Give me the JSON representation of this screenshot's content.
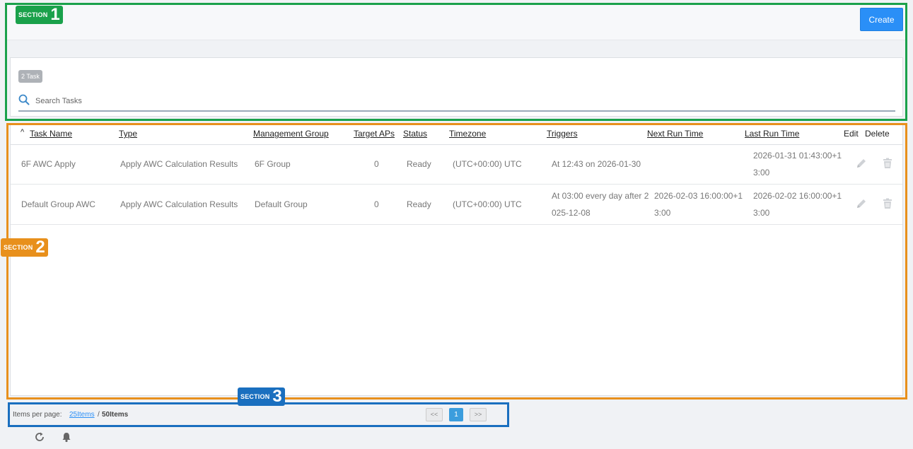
{
  "header": {
    "create_label": "Create"
  },
  "tasks": {
    "count_badge": "2 Task",
    "search_placeholder": "Search Tasks"
  },
  "table": {
    "sort_indicator": "^",
    "columns": {
      "task_name": "Task Name",
      "type": "Type",
      "management_group": "Management Group",
      "target_aps": "Target APs",
      "status": "Status",
      "timezone": "Timezone",
      "triggers": "Triggers",
      "next_run_time": "Next Run Time",
      "last_run_time": "Last Run Time",
      "edit": "Edit",
      "delete": "Delete"
    },
    "rows": [
      {
        "task_name": "6F AWC Apply",
        "type": "Apply AWC Calculation Results",
        "management_group": "6F Group",
        "target_aps": "0",
        "status": "Ready",
        "timezone": "(UTC+00:00) UTC",
        "triggers": "At 12:43 on 2026-01-30",
        "next_run_time": "",
        "last_run_time": "2026-01-31 01:43:00+13:00"
      },
      {
        "task_name": "Default Group AWC",
        "type": "Apply AWC Calculation Results",
        "management_group": "Default Group",
        "target_aps": "0",
        "status": "Ready",
        "timezone": "(UTC+00:00) UTC",
        "triggers": "At 03:00 every day after 2025-12-08",
        "next_run_time": "2026-02-03 16:00:00+13:00",
        "last_run_time": "2026-02-02 16:00:00+13:00"
      }
    ]
  },
  "pagination": {
    "items_per_page_label": "Items per page:",
    "option_selected": "25Items",
    "separator": "/",
    "option_other": "50Items",
    "prev_label": "<<",
    "current_page": "1",
    "next_label": ">>"
  },
  "annotations": [
    {
      "word": "SECTION",
      "number": "1",
      "color": "#1aa14b"
    },
    {
      "word": "SECTION",
      "number": "2",
      "color": "#e8901c"
    },
    {
      "word": "SECTION",
      "number": "3",
      "color": "#1a6fbf"
    }
  ],
  "icons": {
    "search": "search-icon",
    "edit": "pencil-icon",
    "delete": "trash-icon",
    "refresh": "refresh-icon",
    "notifications": "bell-icon"
  },
  "colors": {
    "primary": "#2a8ff7",
    "page_current": "#3b9ddd",
    "section1": "#1aa14b",
    "section2": "#e8901c",
    "section3": "#1a6fbf"
  }
}
